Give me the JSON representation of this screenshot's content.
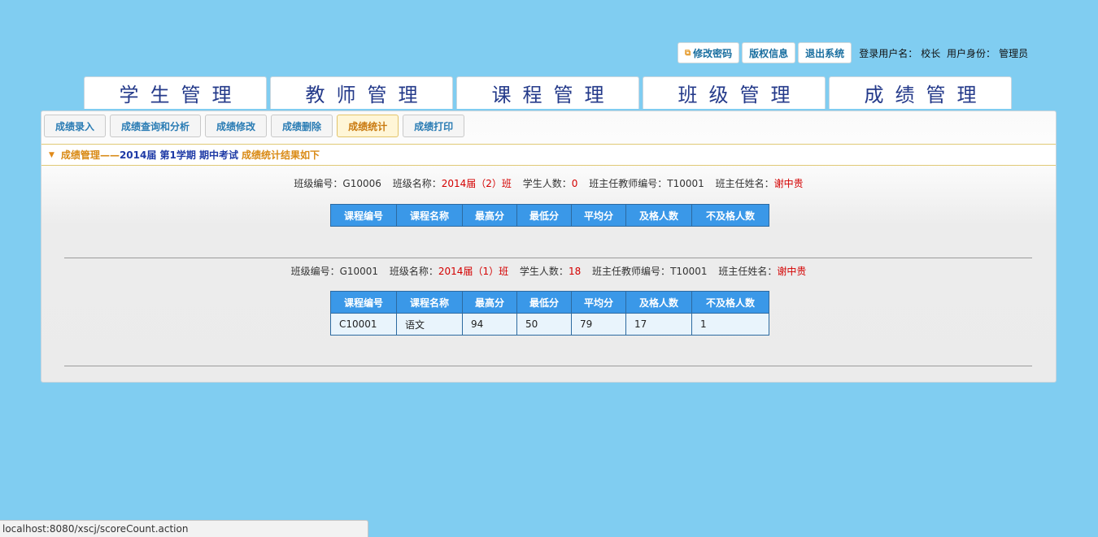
{
  "toolbar": {
    "change_password": "修改密码",
    "copyright": "版权信息",
    "logout": "退出系统",
    "user_label": "登录用户名：",
    "user_name": "校长",
    "role_label": "用户身份：",
    "role_name": "管理员"
  },
  "modules": [
    "学生管理",
    "教师管理",
    "课程管理",
    "班级管理",
    "成绩管理"
  ],
  "subnav": [
    "成绩录入",
    "成绩查询和分析",
    "成绩修改",
    "成绩删除",
    "成绩统计",
    "成绩打印"
  ],
  "subnav_active": "成绩统计",
  "breadcrumb": {
    "module": "成绩管理",
    "separator": "——",
    "exam": "2014届 第1学期 期中考试",
    "result": "成绩统计结果如下"
  },
  "labels": {
    "class_no": "班级编号：",
    "class_name": "班级名称：",
    "student_count": "学生人数：",
    "head_teacher_no": "班主任教师编号：",
    "head_teacher_name": "班主任姓名："
  },
  "table_headers": [
    "课程编号",
    "课程名称",
    "最高分",
    "最低分",
    "平均分",
    "及格人数",
    "不及格人数"
  ],
  "classes": [
    {
      "class_no": "G10006",
      "class_name": "2014届（2）班",
      "student_count": "0",
      "head_teacher_no": "T10001",
      "head_teacher_name": "谢中贵",
      "rows": []
    },
    {
      "class_no": "G10001",
      "class_name": "2014届（1）班",
      "student_count": "18",
      "head_teacher_no": "T10001",
      "head_teacher_name": "谢中贵",
      "rows": [
        [
          "C10001",
          "语文",
          "94",
          "50",
          "79",
          "17",
          "1"
        ]
      ]
    }
  ],
  "status_url": "localhost:8080/xscj/scoreCount.action",
  "colors": {
    "background": "#80cdf1",
    "header_blue": "#3a98e8",
    "accent_orange": "#d98a15",
    "red_value": "#d40000"
  }
}
